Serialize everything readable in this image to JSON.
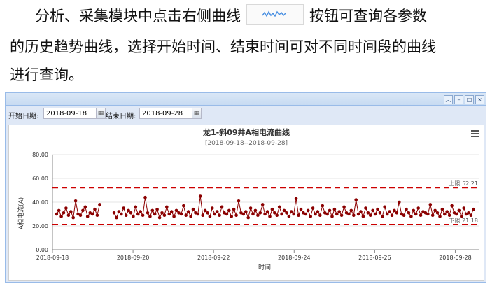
{
  "doc": {
    "line1_before": "分析、采集模块中点击右侧曲线",
    "line1_after": "按钮可查询各参数",
    "line2": "的历史趋势曲线，选择开始时间、结束时间可对不同时间段的曲线",
    "line3": "进行查询。",
    "inline_button_icon": "trend-line-icon"
  },
  "panel": {
    "tools": [
      "collapse-icon",
      "minimize-icon",
      "maximize-icon",
      "close-icon"
    ]
  },
  "toolbar": {
    "start_label": "开始日期:",
    "start_value": "2018-09-18",
    "end_label": "结束日期:",
    "end_value": "2018-09-28",
    "calendar_icon": "calendar-icon"
  },
  "colors": {
    "series": "#8b0000",
    "limit_line": "#cc0000",
    "panel_border": "#99bbe8",
    "panel_bg": "#dfe8f6"
  },
  "chart_data": {
    "type": "line",
    "title": "龙1-斜09井A相电流曲线",
    "subtitle": "[2018-09-18--2018-09-28]",
    "xlabel": "时间",
    "ylabel": "A相电流(A)",
    "x_ticks": [
      "2018-09-18",
      "2018-09-20",
      "2018-09-22",
      "2018-09-24",
      "2018-09-26",
      "2018-09-28"
    ],
    "x_range_days": [
      0,
      10.6
    ],
    "ylim": [
      0,
      80
    ],
    "y_ticks": [
      "0.00",
      "20.00",
      "40.00",
      "60.00",
      "80.00"
    ],
    "limits": [
      {
        "label": "上限:52.21",
        "value": 52.21
      },
      {
        "label": "下限:21.18",
        "value": 21.18
      }
    ],
    "gap_days": [
      1.2,
      1.5
    ],
    "series": [
      {
        "values": [
          30,
          33,
          28,
          31,
          35,
          29,
          32,
          27,
          41,
          30,
          29,
          33,
          36,
          28,
          31,
          30,
          34,
          29,
          38,
          31,
          27,
          32,
          30,
          35,
          29,
          33,
          31,
          28,
          36,
          30,
          32,
          29,
          44,
          31,
          28,
          33,
          30,
          34,
          27,
          31,
          29,
          36,
          30,
          32,
          28,
          33,
          31,
          30,
          37,
          29,
          32,
          28,
          34,
          31,
          30,
          45,
          29,
          33,
          31,
          28,
          35,
          30,
          32,
          29,
          36,
          31,
          30,
          33,
          28,
          34,
          29,
          41,
          31,
          30,
          32,
          27,
          35,
          30,
          33,
          29,
          31,
          38,
          30,
          32,
          28,
          34,
          31,
          29,
          36,
          30,
          33,
          31,
          28,
          32,
          30,
          43,
          29,
          34,
          31,
          30,
          33,
          28,
          35,
          30,
          32,
          29,
          37,
          31,
          30,
          33,
          28,
          34,
          30,
          32,
          29,
          36,
          31,
          30,
          33,
          29,
          42,
          30,
          32,
          28,
          35,
          31,
          29,
          33,
          30,
          34,
          31,
          28,
          36,
          30,
          32,
          29,
          33,
          31,
          40,
          30,
          29,
          34,
          31,
          28,
          33,
          30,
          35,
          29,
          32,
          31,
          30,
          38,
          29,
          33,
          31,
          28,
          34,
          30,
          32,
          29,
          37,
          31,
          30,
          33,
          28,
          35,
          30,
          31,
          29,
          34
        ]
      }
    ]
  }
}
